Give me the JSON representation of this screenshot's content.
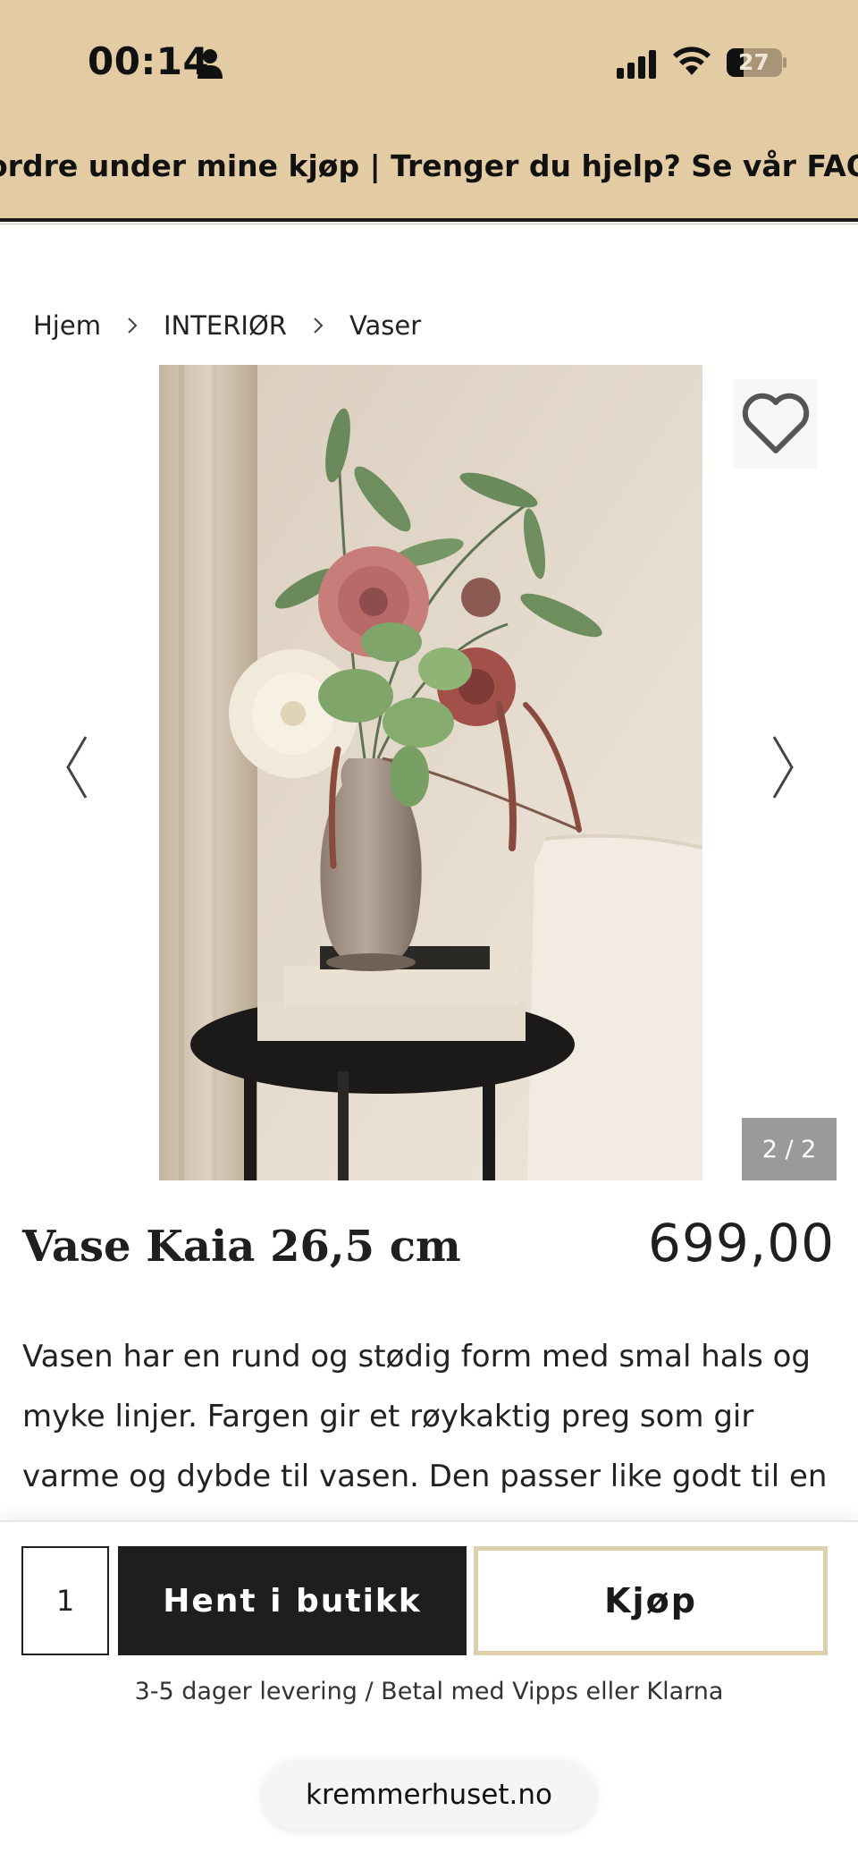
{
  "status_bar": {
    "time": "00:14",
    "battery": "27"
  },
  "announcement": "ordre under mine kjøp | Trenger du hjelp? Se vår FAQ",
  "breadcrumb": {
    "items": [
      "Hjem",
      "INTERIØR",
      "Vaser"
    ]
  },
  "gallery": {
    "counter": "2 / 2"
  },
  "product": {
    "title": "Vase Kaia 26,5 cm",
    "price": "699,00",
    "description": "Vasen har en rund og stødig form med smal hals og myke linjer. Fargen gir et røykaktig preg som gir varme og dybde til vasen. Den passer like godt til en bukett"
  },
  "purchase": {
    "quantity": "1",
    "pickup_label": "Hent i butikk",
    "buy_label": "Kjøp",
    "delivery_info": "3-5 dager levering / Betal med Vipps eller Klarna"
  },
  "browser": {
    "url": "kremmerhuset.no"
  },
  "colors": {
    "topband": "#e3cba4",
    "primary_button": "#1f1e1c",
    "buy_border": "#dfcfac"
  }
}
